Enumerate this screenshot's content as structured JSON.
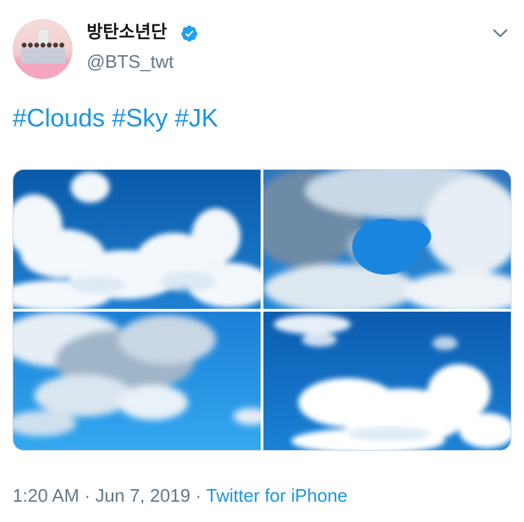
{
  "user": {
    "display_name": "방탄소년단",
    "handle": "@BTS_twt",
    "verified": true
  },
  "tweet": {
    "hashtags": [
      "#Clouds",
      "#Sky",
      "#JK"
    ]
  },
  "media": {
    "photo_count": 4,
    "subjects": [
      "clouds",
      "clouds",
      "clouds",
      "clouds"
    ]
  },
  "meta": {
    "time": "1:20 AM",
    "separator": " · ",
    "date": "Jun 7, 2019",
    "source": "Twitter for iPhone"
  },
  "icons": {
    "verified": "verified-badge-icon",
    "menu": "chevron-down-icon"
  },
  "colors": {
    "link": "#1b95e0",
    "secondary_text": "#657786",
    "primary_text": "#14171a",
    "verified": "#1da1f2"
  }
}
